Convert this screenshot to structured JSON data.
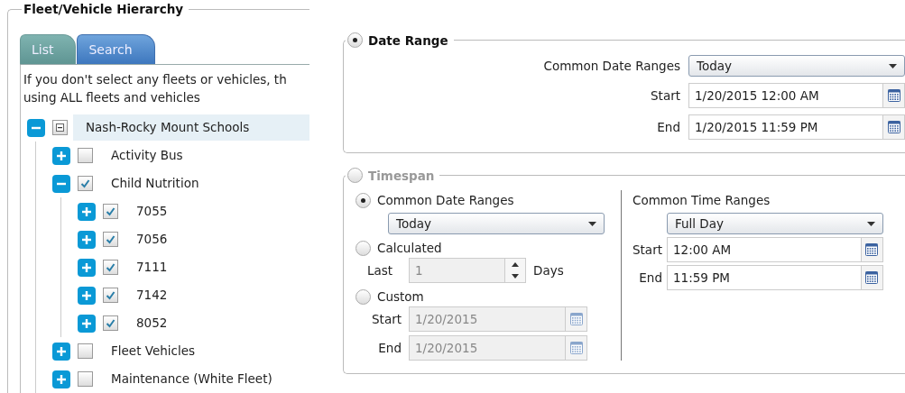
{
  "hierarchy": {
    "title": "Fleet/Vehicle Hierarchy",
    "tabs": [
      {
        "label": "List",
        "selected": true
      },
      {
        "label": "Search",
        "selected": false
      }
    ],
    "notice": [
      "If you don't select any fleets or vehicles, th",
      "using ALL fleets and vehicles"
    ],
    "tree": [
      {
        "label": "Nash-Rocky Mount Schools",
        "expanded": true,
        "indeterminate": true,
        "highlighted": true,
        "children": [
          {
            "label": "Activity Bus",
            "expanded": false,
            "checked": false,
            "highlighted": false
          },
          {
            "label": "Child Nutrition",
            "expanded": true,
            "checked": true,
            "highlighted": false,
            "children": [
              {
                "label": "7055",
                "expanded": false,
                "checked": true,
                "highlighted": false
              },
              {
                "label": "7056",
                "expanded": false,
                "checked": true,
                "highlighted": false
              },
              {
                "label": "7111",
                "expanded": false,
                "checked": true,
                "highlighted": false
              },
              {
                "label": "7142",
                "expanded": false,
                "checked": true,
                "highlighted": false
              },
              {
                "label": "8052",
                "expanded": false,
                "checked": true,
                "highlighted": false
              }
            ]
          },
          {
            "label": "Fleet Vehicles",
            "expanded": false,
            "checked": false,
            "highlighted": false
          },
          {
            "label": "Maintenance (White Fleet)",
            "expanded": false,
            "checked": false,
            "highlighted": false
          }
        ]
      }
    ]
  },
  "date_range": {
    "label": "Date Range",
    "selected": true,
    "common": {
      "label": "Common Date Ranges",
      "value": "Today"
    },
    "fields": [
      {
        "label": "Start",
        "value": "1/20/2015 12:00 AM",
        "disabled": false
      },
      {
        "label": "End",
        "value": "1/20/2015 11:59 PM",
        "disabled": false
      }
    ]
  },
  "timespan": {
    "label": "Timespan",
    "selected": false,
    "options": [
      {
        "kind": "dropdown",
        "label": "Common Date Ranges",
        "selected": true,
        "value": "Today"
      },
      {
        "kind": "spinner",
        "label": "Calculated",
        "selected": false,
        "prefix": "Last",
        "value": "1",
        "suffix": "Days"
      },
      {
        "kind": "dates",
        "label": "Custom",
        "selected": false,
        "fields": [
          {
            "label": "Start",
            "value": "1/20/2015",
            "disabled": true
          },
          {
            "label": "End",
            "value": "1/20/2015",
            "disabled": true
          }
        ]
      }
    ],
    "time": {
      "label": "Common Time Ranges",
      "value": "Full Day",
      "fields": [
        {
          "label": "Start",
          "value": "12:00 AM",
          "disabled": false
        },
        {
          "label": "End",
          "value": "11:59 PM",
          "disabled": false
        }
      ]
    }
  }
}
